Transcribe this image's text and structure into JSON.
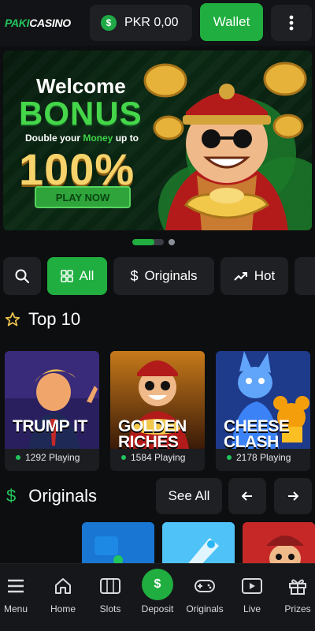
{
  "header": {
    "logo_part1": "PAKI",
    "logo_part2": "CASINO",
    "currency_symbol": "$",
    "balance": "PKR 0,00",
    "wallet_label": "Wallet",
    "more_icon": "kebab-menu-icon"
  },
  "banner": {
    "welcome": "Welcome",
    "bonus": "BONUS",
    "double_a": "Double your ",
    "double_b": "Money",
    "double_c": " up to",
    "percent": "100%",
    "cta": "PLAY NOW",
    "carousel_active_index": 0,
    "carousel_count": 2
  },
  "filters": {
    "search_icon": "search-icon",
    "items": [
      {
        "label": "All",
        "icon": "grid-icon",
        "active": true
      },
      {
        "label": "Originals",
        "icon": "dollar-icon",
        "active": false
      },
      {
        "label": "Hot",
        "icon": "trending-up-icon",
        "active": false
      }
    ]
  },
  "top10": {
    "title": "Top 10",
    "icon": "star-icon",
    "games": [
      {
        "name_line1": "TRUMP IT",
        "name_line2": "",
        "playing": "1292 Playing"
      },
      {
        "name_line1": "GOLDEN",
        "name_line2": "RICHES",
        "playing": "1584 Playing"
      },
      {
        "name_line1": "CHEESE",
        "name_line2": "CLASH",
        "playing": "2178 Playing"
      }
    ]
  },
  "originals": {
    "title": "Originals",
    "icon": "dollar-icon",
    "see_all": "See All",
    "prev_icon": "arrow-left-icon",
    "next_icon": "arrow-right-icon"
  },
  "bottom_nav": {
    "items": [
      {
        "label": "Menu",
        "icon": "menu-icon"
      },
      {
        "label": "Home",
        "icon": "home-icon"
      },
      {
        "label": "Slots",
        "icon": "slots-icon"
      },
      {
        "label": "Deposit",
        "icon": "deposit-icon",
        "symbol": "$"
      },
      {
        "label": "Originals",
        "icon": "gamepad-icon"
      },
      {
        "label": "Live",
        "icon": "play-screen-icon"
      },
      {
        "label": "Prizes",
        "icon": "gift-icon"
      }
    ]
  },
  "colors": {
    "accent": "#1fae3f",
    "background": "#0d0e10",
    "surface": "#1e2024",
    "gold": "#f6d36b"
  }
}
